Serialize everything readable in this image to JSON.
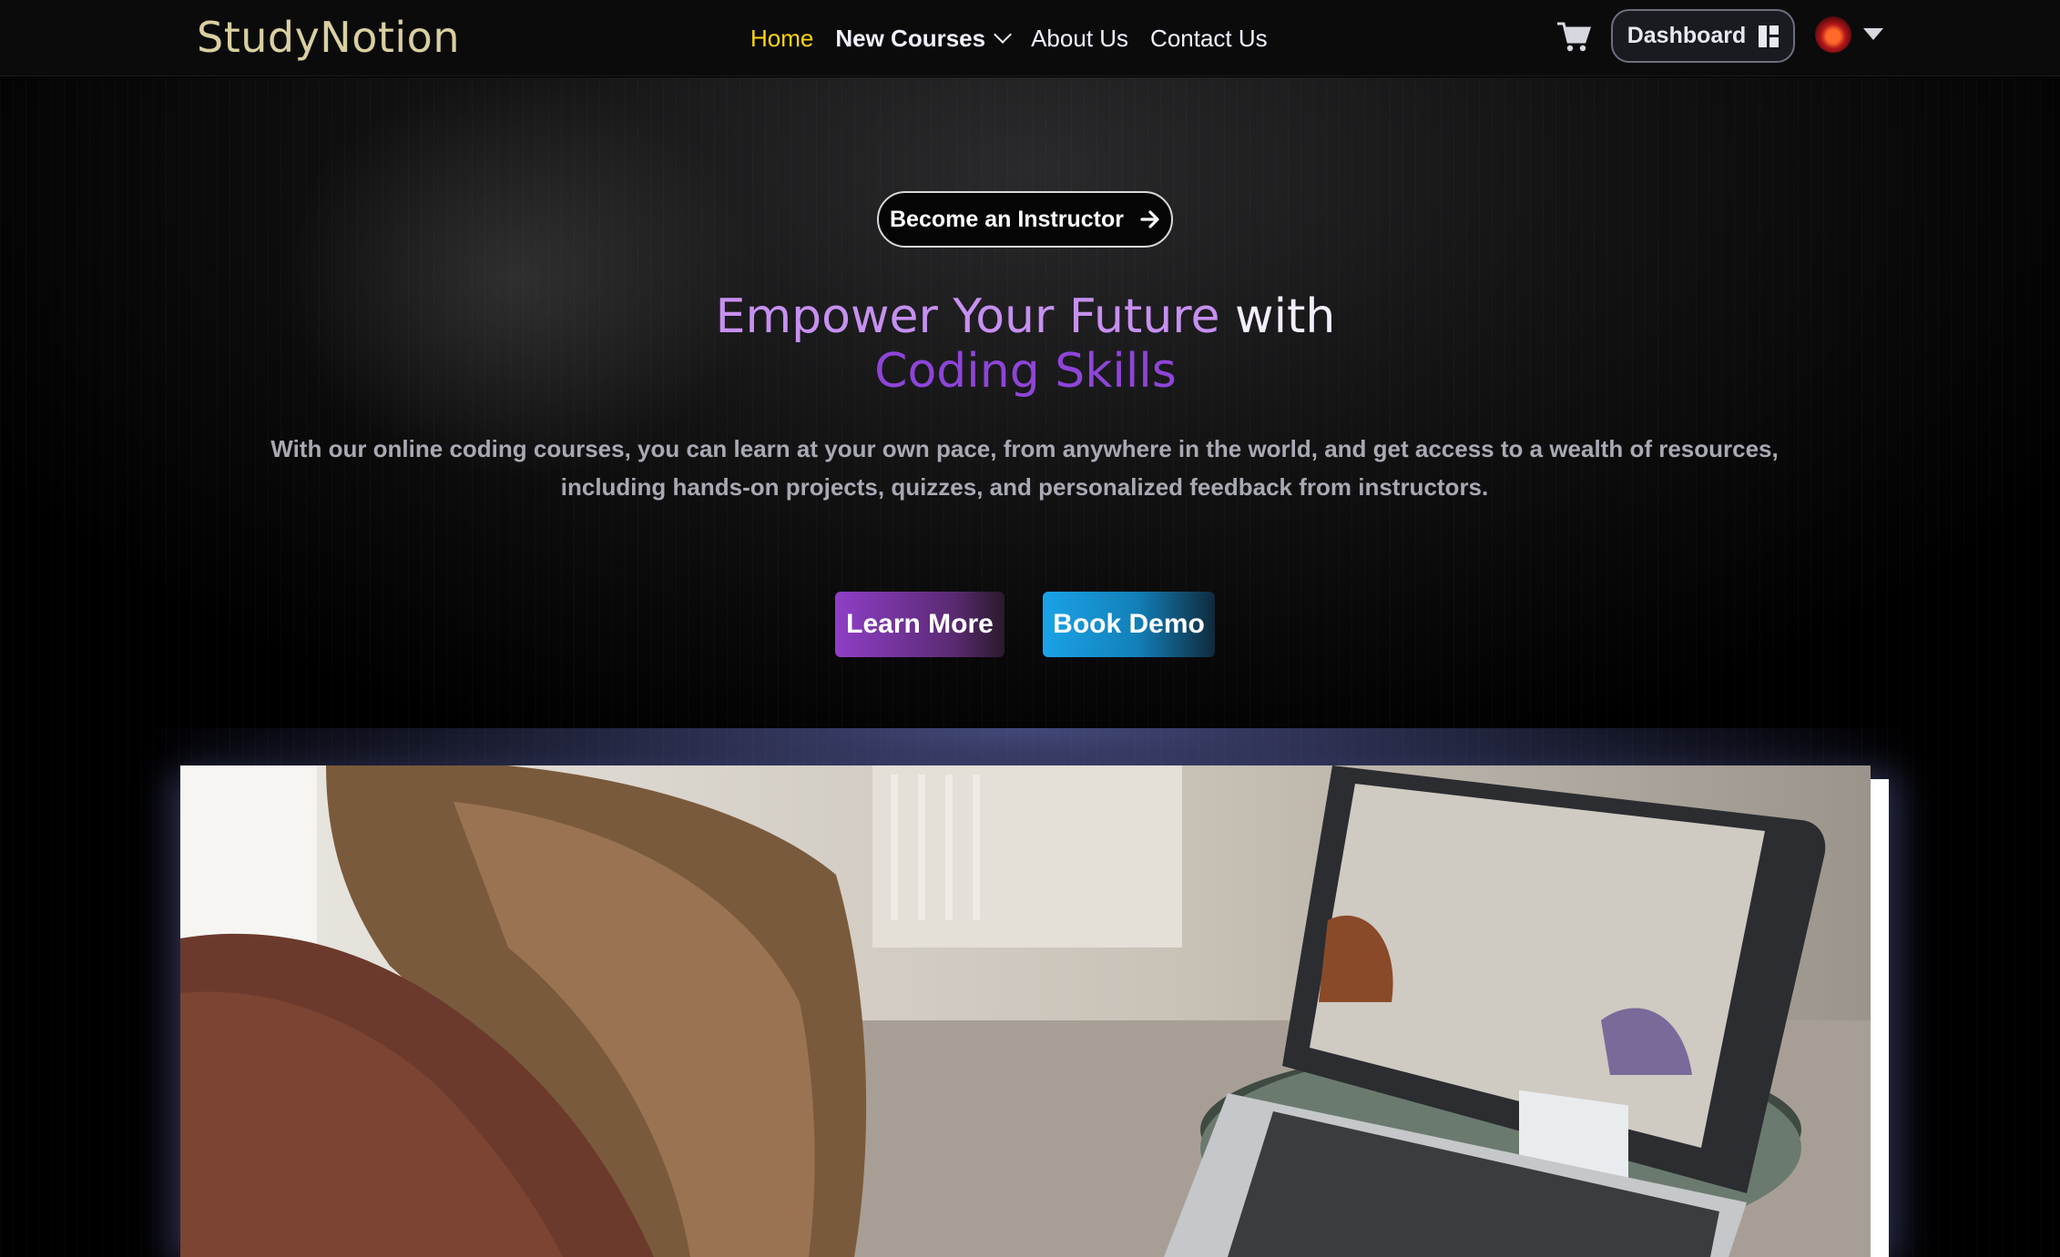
{
  "navbar": {
    "logo": "StudyNotion",
    "links": [
      {
        "label": "Home",
        "active": true
      },
      {
        "label": "New Courses",
        "has_dropdown": true
      },
      {
        "label": "About Us"
      },
      {
        "label": "Contact Us"
      }
    ],
    "cart_icon": "cart-icon",
    "dashboard_label": "Dashboard",
    "dashboard_icon": "layout-icon",
    "avatar_icon": "avatar",
    "menu_caret_icon": "caret-down-icon"
  },
  "hero": {
    "instructor_button": "Become an Instructor",
    "headline_part1": "Empower Your Future",
    "headline_part2": " with",
    "headline_line2": "Coding Skills",
    "subtext": "With our online coding courses, you can learn at your own pace, from anywhere in the world, and get access to a wealth of resources, including hands-on projects, quizzes, and personalized feedback from instructors.",
    "learn_more": "Learn More",
    "book_demo": "Book Demo"
  },
  "colors": {
    "accent_yellow": "#ffd60a",
    "headline_purple": "#c690f0",
    "headline_deep_purple": "#8e45d8",
    "learn_more_bg": "#8f3fc7",
    "book_demo_bg": "#1aa3e8"
  },
  "video": {
    "description_icon": "video-player"
  }
}
